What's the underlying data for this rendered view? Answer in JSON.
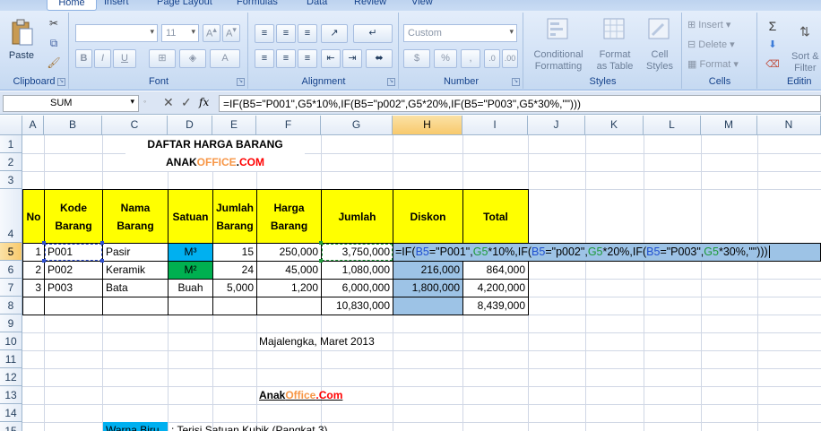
{
  "tabs": [
    "Home",
    "Insert",
    "Page Layout",
    "Formulas",
    "Data",
    "Review",
    "View"
  ],
  "ribbon": {
    "clipboard": {
      "label": "Clipboard",
      "paste": "Paste"
    },
    "font": {
      "label": "Font",
      "name": "",
      "size": "11",
      "bold": "B",
      "italic": "I",
      "underline": "U"
    },
    "alignment": {
      "label": "Alignment"
    },
    "number": {
      "label": "Number",
      "format": "Custom",
      "currency": "$",
      "percent": "%",
      "comma": ","
    },
    "styles": {
      "label": "Styles",
      "conditional": [
        "Conditional",
        "Formatting"
      ],
      "format_table": [
        "Format",
        "as Table"
      ],
      "cell_styles": [
        "Cell",
        "Styles"
      ]
    },
    "cells": {
      "label": "Cells",
      "insert": "Insert",
      "delete": "Delete",
      "format": "Format"
    },
    "editing": {
      "label": "Editin",
      "sort": [
        "Sort &",
        "Filter"
      ]
    }
  },
  "formula_bar": {
    "name_box": "SUM",
    "fx": "fx",
    "formula": "=IF(B5=\"P001\",G5*10%,IF(B5=\"p002\",G5*20%,IF(B5=\"P003\",G5*30%,\"\")))"
  },
  "columns": [
    "A",
    "B",
    "C",
    "D",
    "E",
    "F",
    "G",
    "H",
    "I",
    "J",
    "K",
    "L",
    "M",
    "N"
  ],
  "rows": [
    "1",
    "2",
    "3",
    "4",
    "5",
    "6",
    "7",
    "8",
    "9",
    "10",
    "11",
    "12",
    "13",
    "14",
    "15"
  ],
  "sheet": {
    "title": "DAFTAR HARGA BARANG",
    "site": {
      "black": "ANAK",
      "orange": "OFFICE",
      "dot": ".",
      "red": "COM"
    },
    "headers": {
      "no": "No",
      "kode": "Kode Barang",
      "nama": "Nama Barang",
      "satuan": "Satuan",
      "jumlah_barang": "Jumlah Barang",
      "harga": "Harga Barang",
      "jumlah": "Jumlah",
      "diskon": "Diskon",
      "total": "Total"
    },
    "items": [
      {
        "no": "1",
        "kode": "P001",
        "nama": "Pasir",
        "satuan": "M³",
        "jumlah_barang": "15",
        "harga": "250,000",
        "jumlah": "3,750,000",
        "diskon": "",
        "total": ""
      },
      {
        "no": "2",
        "kode": "P002",
        "nama": "Keramik",
        "satuan": "M²",
        "jumlah_barang": "24",
        "harga": "45,000",
        "jumlah": "1,080,000",
        "diskon": "216,000",
        "total": "864,000"
      },
      {
        "no": "3",
        "kode": "P003",
        "nama": "Bata",
        "satuan": "Buah",
        "jumlah_barang": "5,000",
        "harga": "1,200",
        "jumlah": "6,000,000",
        "diskon": "1,800,000",
        "total": "4,200,000"
      }
    ],
    "sum_jumlah": "10,830,000",
    "sum_total": "8,439,000",
    "edit_formula": {
      "p1": "=IF(",
      "r1": "B5",
      "p2": "=\"P001\",",
      "r2": "G5",
      "p3": "*10%,IF(",
      "r3": "B5",
      "p4": "=\"p002\",",
      "r4": "G5",
      "p5": "*20%,IF(",
      "r6": "B5",
      "p6": "=\"P003\",",
      "r7": "G5",
      "p7": "*30%,\"\")))"
    },
    "place_date": "Majalengka,  Maret 2013",
    "footer_site": {
      "black": "Anak",
      "orange": "Office",
      "red": ".Com"
    },
    "legend_label": "Warna Biru",
    "legend_text": ": Terisi Satuan Kubik (Pangkat 3)"
  },
  "colors": {
    "yellow": "#ffff00",
    "blue": "#00b0f0",
    "green": "#00b050",
    "selection": "#9dc3e6",
    "orange": "#f79646",
    "red": "#ff0000"
  }
}
